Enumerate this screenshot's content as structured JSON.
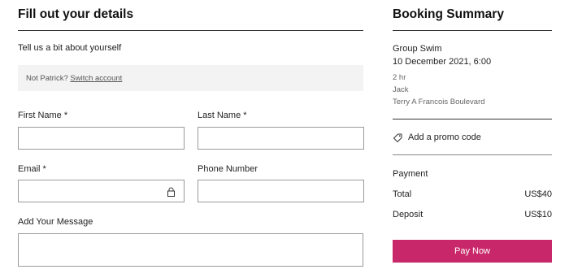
{
  "form": {
    "title": "Fill out your details",
    "subtitle": "Tell us a bit about yourself",
    "notice_text": "Not Patrick?",
    "switch_link": "Switch account",
    "first_name_label": "First Name *",
    "first_name_value": "",
    "last_name_label": "Last Name *",
    "last_name_value": "",
    "email_label": "Email *",
    "email_value": "",
    "phone_label": "Phone Number",
    "phone_value": "",
    "message_label": "Add Your Message",
    "message_value": ""
  },
  "summary": {
    "title": "Booking Summary",
    "service": "Group Swim",
    "datetime": "10 December 2021, 6:00",
    "duration": "2 hr",
    "staff": "Jack",
    "location": "Terry A Francois Boulevard",
    "promo_label": "Add a promo code",
    "payment_heading": "Payment",
    "total_label": "Total",
    "total_value": "US$40",
    "deposit_label": "Deposit",
    "deposit_value": "US$10",
    "pay_button": "Pay Now"
  },
  "icons": {
    "lock": "lock-icon",
    "tag": "tag-icon"
  },
  "colors": {
    "accent": "#c8286a",
    "notice_bg": "#f3f3f3"
  }
}
